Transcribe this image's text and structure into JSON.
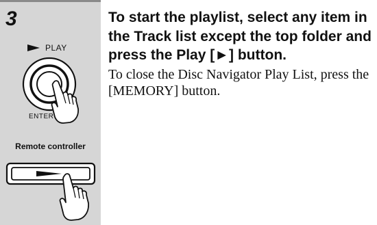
{
  "step": {
    "number": "3"
  },
  "illustration": {
    "play_label": "PLAY",
    "enter_label": "ENTER",
    "remote_label": "Remote controller"
  },
  "instruction": {
    "heading": "To start the playlist, select any item in the Track list except the top folder and press the Play [►] button.",
    "body": "To close the Disc Navigator Play List, press the [MEMORY] button."
  },
  "colors": {
    "sidebar_bg": "#d6d6d6",
    "sidebar_rule": "#8a8a8a",
    "text": "#111111"
  }
}
